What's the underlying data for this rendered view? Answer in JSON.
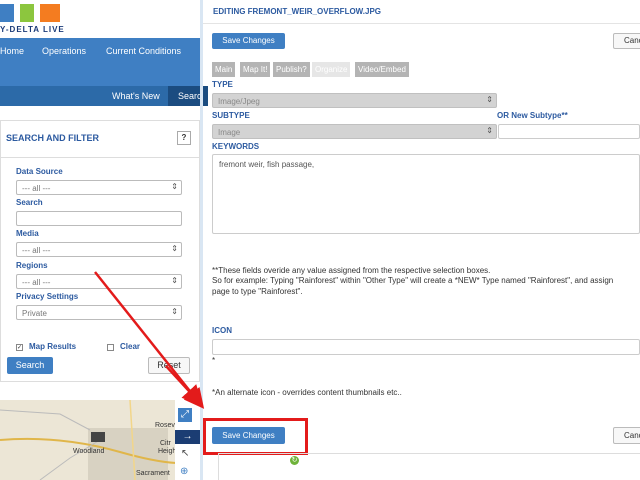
{
  "site": {
    "tagline": "Y-DELTA LIVE",
    "nav": [
      "Home",
      "Operations",
      "Current Conditions"
    ],
    "subnav": [
      "What's New",
      "Searc"
    ]
  },
  "search_panel": {
    "title": "SEARCH AND FILTER",
    "help": "?",
    "data_source_label": "Data Source",
    "data_source_value": "--- all ---",
    "search_label": "Search",
    "media_label": "Media",
    "media_value": "--- all ---",
    "regions_label": "Regions",
    "regions_value": "--- all ---",
    "privacy_label": "Privacy Settings",
    "privacy_value": "Private",
    "map_results_label": "Map Results",
    "clear_label": "Clear",
    "search_button": "Search",
    "reset_button": "Reset"
  },
  "map": {
    "labels": [
      "Roseville",
      "Citr",
      "Heigh",
      "Woodland",
      "Sacrament"
    ]
  },
  "editor": {
    "header": "EDITING FREMONT_WEIR_OVERFLOW.JPG",
    "save_button": "Save Changes",
    "cancel_button": "Canc",
    "tabs": [
      "Main",
      "Map It!",
      "Publish?",
      "Organize",
      "Video/Embed"
    ],
    "type_label": "TYPE",
    "type_value": "Image/Jpeg",
    "subtype_label": "SUBTYPE",
    "subtype_value": "Image",
    "new_subtype_label": "OR New Subtype**",
    "keywords_label": "KEYWORDS",
    "keywords_value": "fremont weir, fish passage,",
    "note_line1": "**These fields overide any value assigned from the respective selection boxes.",
    "note_line2": "So for example: Typing \"Rainforest\" within \"Other Type\" will create a *NEW* Type named \"Rainforest\", and assign",
    "note_line3": "page to type \"Rainforest\".",
    "icon_label": "ICON",
    "icon_asterisk": "*",
    "icon_note": "*An alternate icon - overrides content thumbnails etc..",
    "save_button_bottom": "Save Changes",
    "cancel_button_bottom": "Canc"
  },
  "colors": {
    "primary_blue": "#3f7fc3",
    "highlight_red": "#e31b1b"
  }
}
